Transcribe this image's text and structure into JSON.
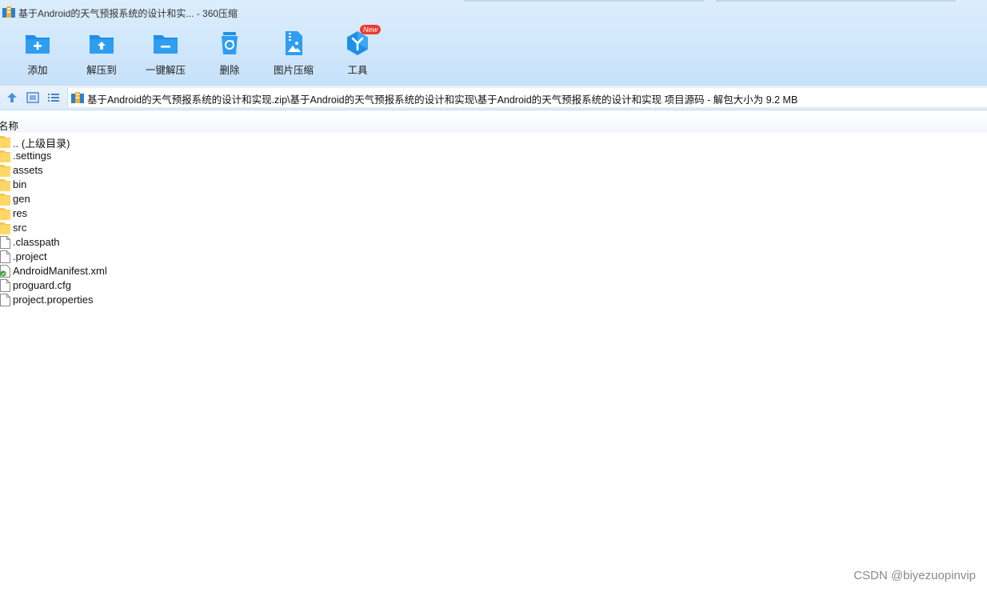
{
  "window": {
    "title": "基于Android的天气预报系统的设计和实... - 360压缩"
  },
  "toolbar": {
    "items": [
      {
        "label": "添加",
        "icon": "add-icon"
      },
      {
        "label": "解压到",
        "icon": "extract-to-icon"
      },
      {
        "label": "一键解压",
        "icon": "one-click-extract-icon"
      },
      {
        "label": "删除",
        "icon": "delete-icon"
      },
      {
        "label": "图片压缩",
        "icon": "image-compress-icon"
      },
      {
        "label": "工具",
        "icon": "tools-icon",
        "badge": "New"
      }
    ]
  },
  "address": {
    "path": "基于Android的天气预报系统的设计和实现.zip\\基于Android的天气预报系统的设计和实现\\基于Android的天气预报系统的设计和实现 项目源码 - 解包大小为 9.2 MB"
  },
  "list": {
    "column_name": "名称",
    "items": [
      {
        "name": ".. (上级目录)",
        "type": "folder"
      },
      {
        "name": ".settings",
        "type": "folder"
      },
      {
        "name": "assets",
        "type": "folder"
      },
      {
        "name": "bin",
        "type": "folder"
      },
      {
        "name": "gen",
        "type": "folder"
      },
      {
        "name": "res",
        "type": "folder"
      },
      {
        "name": "src",
        "type": "folder"
      },
      {
        "name": ".classpath",
        "type": "file"
      },
      {
        "name": ".project",
        "type": "file"
      },
      {
        "name": "AndroidManifest.xml",
        "type": "xml"
      },
      {
        "name": "proguard.cfg",
        "type": "file"
      },
      {
        "name": "project.properties",
        "type": "file"
      }
    ]
  },
  "watermark": "CSDN @biyezuopinvip",
  "colors": {
    "toolbar_bg": "#cfe6fb",
    "icon_blue": "#1e8fe6",
    "folder_yellow": "#ffd766",
    "badge_red": "#ef3b2d"
  }
}
